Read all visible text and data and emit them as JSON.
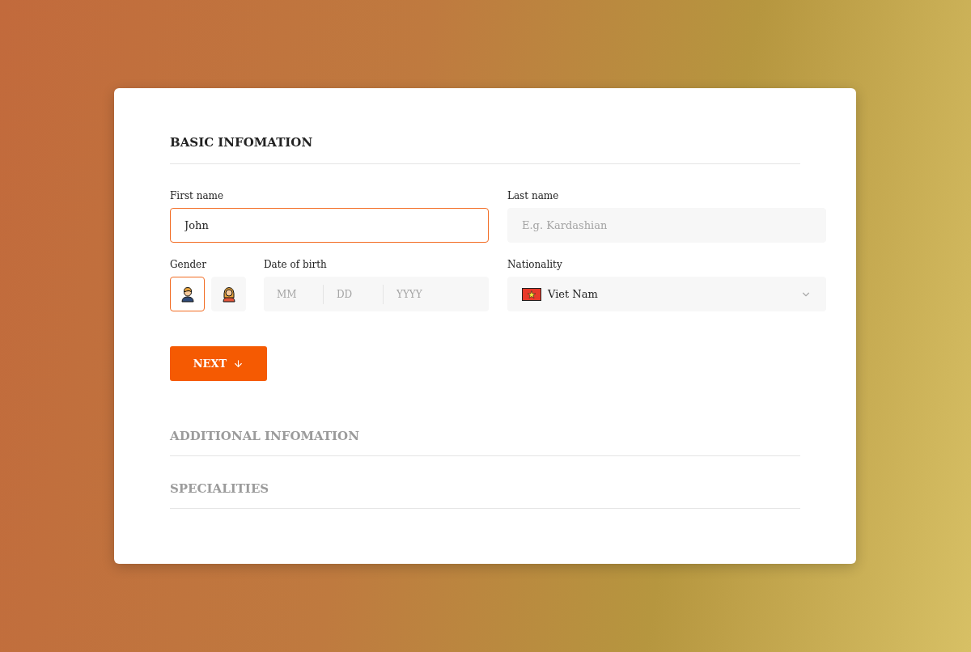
{
  "sections": [
    {
      "title": "BASIC INFOMATION",
      "expanded": true
    },
    {
      "title": "ADDITIONAL INFOMATION",
      "expanded": false
    },
    {
      "title": "SPECIALITIES",
      "expanded": false
    }
  ],
  "first_name": {
    "label": "First name",
    "value": "John",
    "focused": true
  },
  "last_name": {
    "label": "Last name",
    "placeholder": "E.g. Kardashian",
    "focused": false
  },
  "gender": {
    "label": "Gender",
    "options": [
      {
        "kind": "male",
        "selected": true
      },
      {
        "kind": "female",
        "selected": false
      }
    ]
  },
  "date_of_birth": {
    "label": "Date of birth",
    "parts": [
      {
        "placeholder": "MM"
      },
      {
        "placeholder": "DD"
      },
      {
        "placeholder": "YYYY"
      }
    ]
  },
  "nationality": {
    "label": "Nationality",
    "value": "Viet Nam"
  },
  "next_button": {
    "label": "NEXT"
  }
}
